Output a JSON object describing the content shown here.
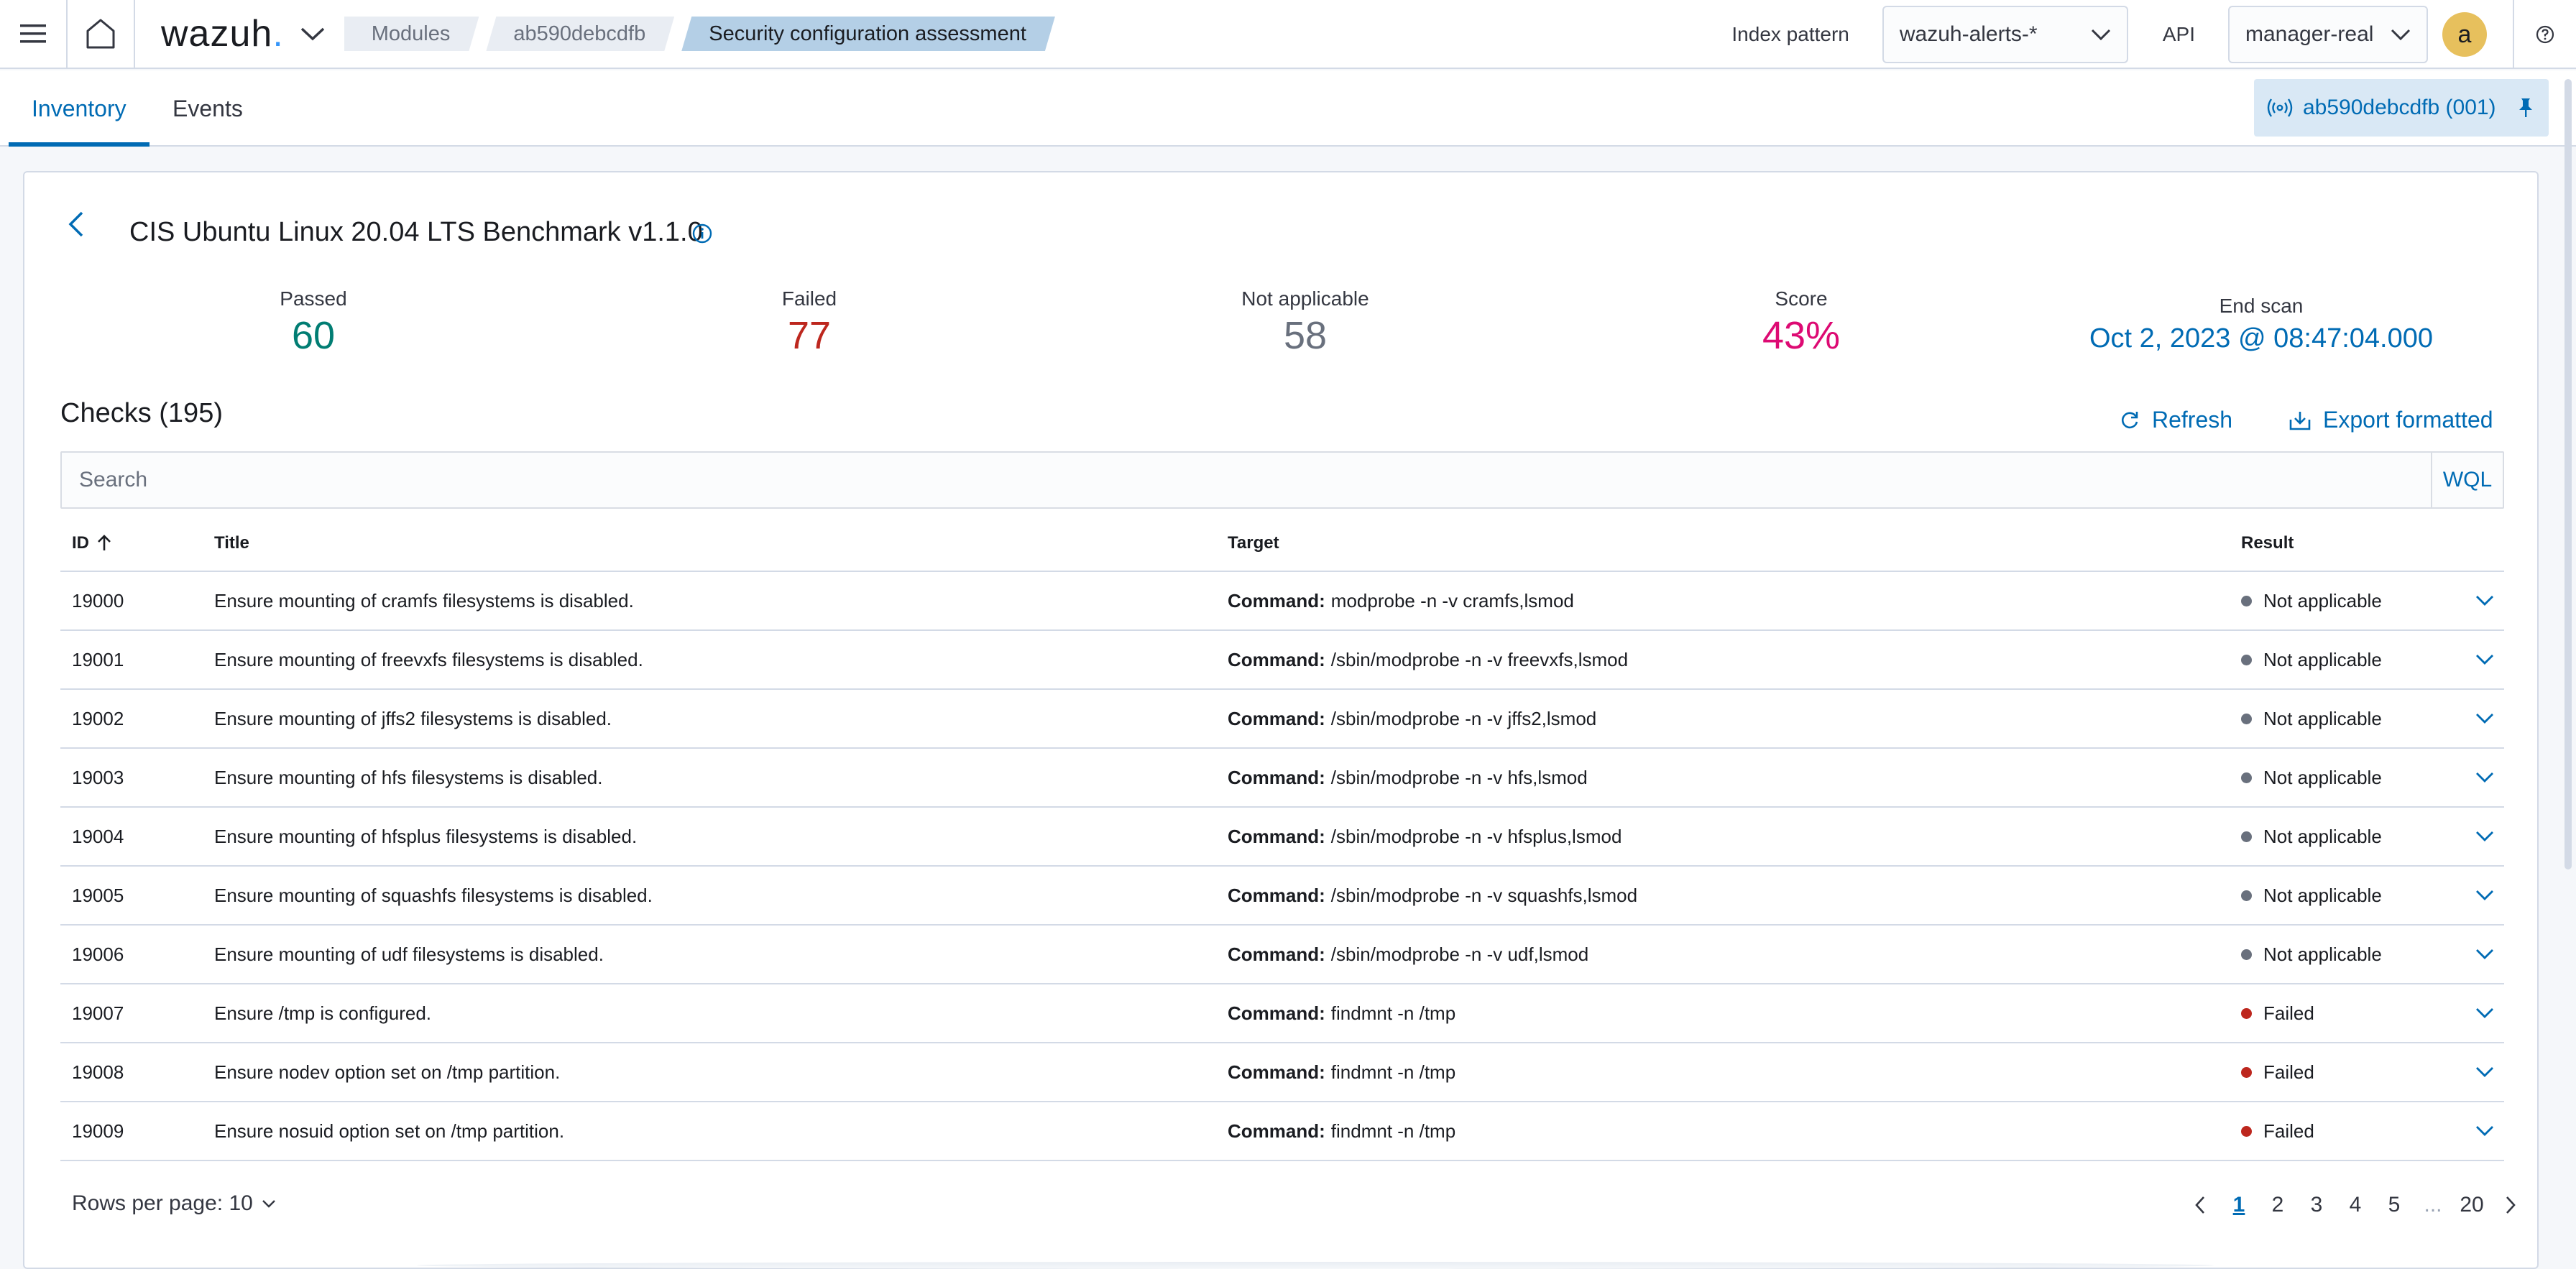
{
  "header": {
    "logo_text": "wazuh",
    "logo_dot": ".",
    "breadcrumbs": [
      "Modules",
      "ab590debcdfb",
      "Security configuration assessment"
    ],
    "index_pattern_label": "Index pattern",
    "index_pattern_value": "wazuh-alerts-*",
    "api_label": "API",
    "api_value": "manager-real",
    "avatar_letter": "a"
  },
  "tabs": {
    "inventory": "Inventory",
    "events": "Events",
    "agent_pill": "ab590debcdfb (001)"
  },
  "policy": {
    "title": "CIS Ubuntu Linux 20.04 LTS Benchmark v1.1.0"
  },
  "stats": {
    "passed_label": "Passed",
    "passed_value": "60",
    "failed_label": "Failed",
    "failed_value": "77",
    "na_label": "Not applicable",
    "na_value": "58",
    "score_label": "Score",
    "score_value": "43%",
    "end_scan_label": "End scan",
    "end_scan_value": "Oct 2, 2023 @ 08:47:04.000"
  },
  "colors": {
    "passed": "#017d73",
    "failed": "#bd271e",
    "na": "#69707d",
    "score": "#dd0a73",
    "link": "#006bb4",
    "dot_na": "#69707d",
    "dot_failed": "#bd271e"
  },
  "checks": {
    "title": "Checks (195)",
    "refresh_label": "Refresh",
    "export_label": "Export formatted",
    "search_placeholder": "Search",
    "wql_label": "WQL",
    "columns": {
      "id": "ID",
      "title": "Title",
      "target": "Target",
      "result": "Result"
    },
    "command_label": "Command:",
    "rows": [
      {
        "id": "19000",
        "title": "Ensure mounting of cramfs filesystems is disabled.",
        "target": "modprobe -n -v cramfs,lsmod",
        "result": "Not applicable"
      },
      {
        "id": "19001",
        "title": "Ensure mounting of freevxfs filesystems is disabled.",
        "target": "/sbin/modprobe -n -v freevxfs,lsmod",
        "result": "Not applicable"
      },
      {
        "id": "19002",
        "title": "Ensure mounting of jffs2 filesystems is disabled.",
        "target": "/sbin/modprobe -n -v jffs2,lsmod",
        "result": "Not applicable"
      },
      {
        "id": "19003",
        "title": "Ensure mounting of hfs filesystems is disabled.",
        "target": "/sbin/modprobe -n -v hfs,lsmod",
        "result": "Not applicable"
      },
      {
        "id": "19004",
        "title": "Ensure mounting of hfsplus filesystems is disabled.",
        "target": "/sbin/modprobe -n -v hfsplus,lsmod",
        "result": "Not applicable"
      },
      {
        "id": "19005",
        "title": "Ensure mounting of squashfs filesystems is disabled.",
        "target": "/sbin/modprobe -n -v squashfs,lsmod",
        "result": "Not applicable"
      },
      {
        "id": "19006",
        "title": "Ensure mounting of udf filesystems is disabled.",
        "target": "/sbin/modprobe -n -v udf,lsmod",
        "result": "Not applicable"
      },
      {
        "id": "19007",
        "title": "Ensure /tmp is configured.",
        "target": "findmnt -n /tmp",
        "result": "Failed"
      },
      {
        "id": "19008",
        "title": "Ensure nodev option set on /tmp partition.",
        "target": "findmnt -n /tmp",
        "result": "Failed"
      },
      {
        "id": "19009",
        "title": "Ensure nosuid option set on /tmp partition.",
        "target": "findmnt -n /tmp",
        "result": "Failed"
      }
    ]
  },
  "pagination": {
    "rows_per_page": "Rows per page: 10",
    "pages": [
      "1",
      "2",
      "3",
      "4",
      "5",
      "...",
      "20"
    ],
    "current": "1"
  }
}
